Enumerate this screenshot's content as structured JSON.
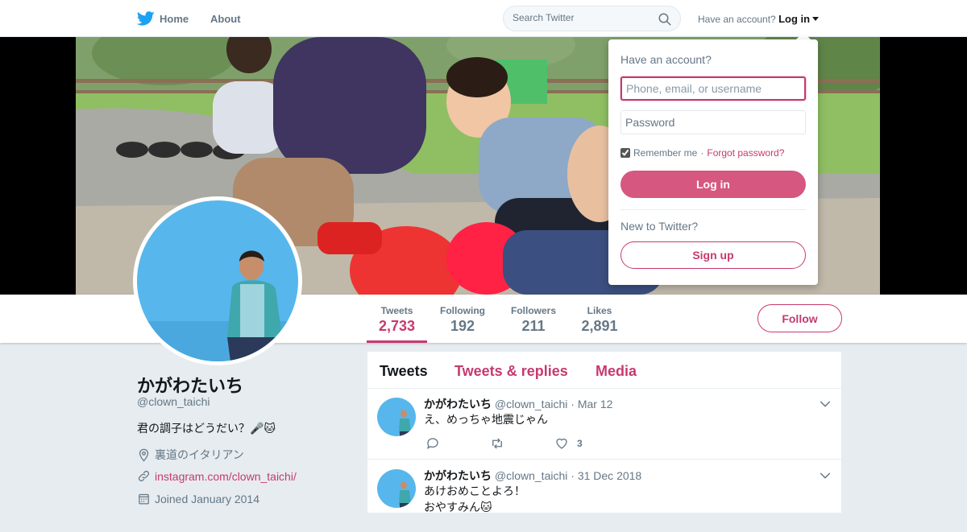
{
  "nav": {
    "home_label": "Home",
    "about_label": "About",
    "search_placeholder": "Search Twitter",
    "account_prompt": "Have an account?",
    "login_label": "Log in"
  },
  "profile_nav": {
    "stats": [
      {
        "label": "Tweets",
        "value": "2,733",
        "active": true
      },
      {
        "label": "Following",
        "value": "192"
      },
      {
        "label": "Followers",
        "value": "211"
      },
      {
        "label": "Likes",
        "value": "2,891"
      }
    ],
    "follow_label": "Follow"
  },
  "profile": {
    "name": "かがわたいち",
    "handle": "@clown_taichi",
    "bio": "君の調子はどうだい？🎤🐱",
    "location": "裏道のイタリアン",
    "link": "instagram.com/clown_taichi/",
    "joined": "Joined January 2014"
  },
  "timeline": {
    "tabs": [
      "Tweets",
      "Tweets & replies",
      "Media"
    ],
    "tweets": [
      {
        "name": "かがわたいち",
        "handle": "@clown_taichi",
        "date": "· Mar 12",
        "text_lines": [
          "え、めっちゃ地震じゃん"
        ],
        "likes": "3"
      },
      {
        "name": "かがわたいち",
        "handle": "@clown_taichi",
        "date": "· 31 Dec 2018",
        "text_lines": [
          "あけおめことよろ！",
          "おやすみん🐱"
        ]
      }
    ]
  },
  "login_dropdown": {
    "title": "Have an account?",
    "username_placeholder": "Phone, email, or username",
    "password_placeholder": "Password",
    "remember_label": "Remember me",
    "separator": "·",
    "forgot_label": "Forgot password?",
    "login_button": "Log in",
    "new_prompt": "New to Twitter?",
    "signup_button": "Sign up"
  },
  "colors": {
    "accent": "#c63a6f",
    "login_button_bg": "#d6577f",
    "twitter_blue": "#1da1f2",
    "muted_text": "#657786",
    "page_bg": "#e6ecf0"
  }
}
